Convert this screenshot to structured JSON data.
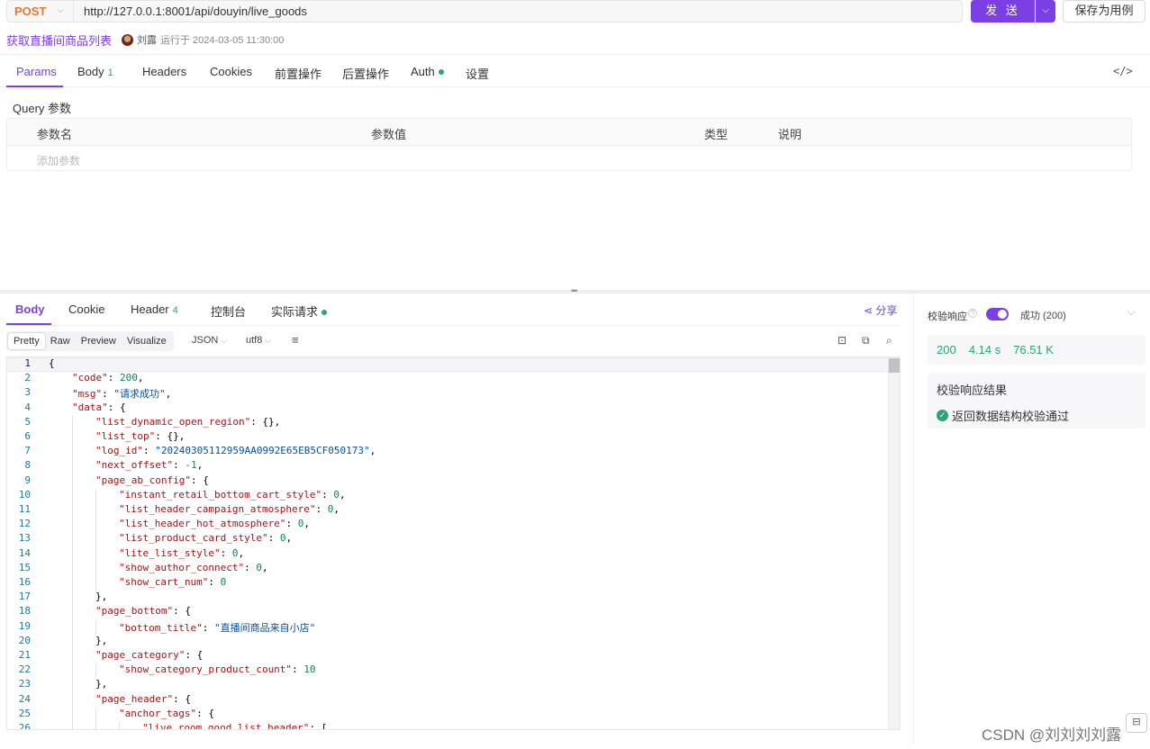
{
  "request": {
    "method": "POST",
    "url": "http://127.0.0.1:8001/api/douyin/live_goods",
    "send_label": "发 送",
    "save_case_label": "保存为用例",
    "case_name": "获取直播间商品列表",
    "runner_name": "刘露",
    "run_info": "运行于 2024-03-05 11:30:00"
  },
  "request_tabs": {
    "params": "Params",
    "body": "Body",
    "body_count": "1",
    "headers": "Headers",
    "cookies": "Cookies",
    "pre": "前置操作",
    "post": "后置操作",
    "auth": "Auth",
    "settings": "设置",
    "code_icon": "</>"
  },
  "query": {
    "title": "Query 参数",
    "columns": [
      "参数名",
      "参数值",
      "类型",
      "说明"
    ],
    "add_placeholder": "添加参数"
  },
  "response_tabs": {
    "body": "Body",
    "cookie": "Cookie",
    "header": "Header",
    "header_count": "4",
    "console": "控制台",
    "actual_request": "实际请求",
    "share": "分享"
  },
  "toolbar": {
    "views": [
      "Pretty",
      "Raw",
      "Preview",
      "Visualize"
    ],
    "format": "JSON",
    "encoding": "utf8"
  },
  "code_lines": [
    {
      "n": "1",
      "i": 0,
      "t": [
        [
          "p",
          "{"
        ]
      ]
    },
    {
      "n": "2",
      "i": 1,
      "t": [
        [
          "k",
          "\"code\""
        ],
        [
          "p",
          ": "
        ],
        [
          "n",
          "200"
        ],
        [
          "p",
          ","
        ]
      ]
    },
    {
      "n": "3",
      "i": 1,
      "t": [
        [
          "k",
          "\"msg\""
        ],
        [
          "p",
          ": "
        ],
        [
          "s",
          "\"请求成功\""
        ],
        [
          "p",
          ","
        ]
      ]
    },
    {
      "n": "4",
      "i": 1,
      "t": [
        [
          "k",
          "\"data\""
        ],
        [
          "p",
          ": {"
        ]
      ]
    },
    {
      "n": "5",
      "i": 2,
      "t": [
        [
          "k",
          "\"list_dynamic_open_region\""
        ],
        [
          "p",
          ": {},"
        ]
      ]
    },
    {
      "n": "6",
      "i": 2,
      "t": [
        [
          "k",
          "\"list_top\""
        ],
        [
          "p",
          ": {},"
        ]
      ]
    },
    {
      "n": "7",
      "i": 2,
      "t": [
        [
          "k",
          "\"log_id\""
        ],
        [
          "p",
          ": "
        ],
        [
          "s",
          "\"20240305112959AA0992E65EB5CF050173\""
        ],
        [
          "p",
          ","
        ]
      ]
    },
    {
      "n": "8",
      "i": 2,
      "t": [
        [
          "k",
          "\"next_offset\""
        ],
        [
          "p",
          ": "
        ],
        [
          "n",
          "-1"
        ],
        [
          "p",
          ","
        ]
      ]
    },
    {
      "n": "9",
      "i": 2,
      "t": [
        [
          "k",
          "\"page_ab_config\""
        ],
        [
          "p",
          ": {"
        ]
      ]
    },
    {
      "n": "10",
      "i": 3,
      "t": [
        [
          "k",
          "\"instant_retail_bottom_cart_style\""
        ],
        [
          "p",
          ": "
        ],
        [
          "n",
          "0"
        ],
        [
          "p",
          ","
        ]
      ]
    },
    {
      "n": "11",
      "i": 3,
      "t": [
        [
          "k",
          "\"list_header_campaign_atmosphere\""
        ],
        [
          "p",
          ": "
        ],
        [
          "n",
          "0"
        ],
        [
          "p",
          ","
        ]
      ]
    },
    {
      "n": "12",
      "i": 3,
      "t": [
        [
          "k",
          "\"list_header_hot_atmosphere\""
        ],
        [
          "p",
          ": "
        ],
        [
          "n",
          "0"
        ],
        [
          "p",
          ","
        ]
      ]
    },
    {
      "n": "13",
      "i": 3,
      "t": [
        [
          "k",
          "\"list_product_card_style\""
        ],
        [
          "p",
          ": "
        ],
        [
          "n",
          "0"
        ],
        [
          "p",
          ","
        ]
      ]
    },
    {
      "n": "14",
      "i": 3,
      "t": [
        [
          "k",
          "\"lite_list_style\""
        ],
        [
          "p",
          ": "
        ],
        [
          "n",
          "0"
        ],
        [
          "p",
          ","
        ]
      ]
    },
    {
      "n": "15",
      "i": 3,
      "t": [
        [
          "k",
          "\"show_author_connect\""
        ],
        [
          "p",
          ": "
        ],
        [
          "n",
          "0"
        ],
        [
          "p",
          ","
        ]
      ]
    },
    {
      "n": "16",
      "i": 3,
      "t": [
        [
          "k",
          "\"show_cart_num\""
        ],
        [
          "p",
          ": "
        ],
        [
          "n",
          "0"
        ]
      ]
    },
    {
      "n": "17",
      "i": 2,
      "t": [
        [
          "p",
          "},"
        ]
      ]
    },
    {
      "n": "18",
      "i": 2,
      "t": [
        [
          "k",
          "\"page_bottom\""
        ],
        [
          "p",
          ": {"
        ]
      ]
    },
    {
      "n": "19",
      "i": 3,
      "t": [
        [
          "k",
          "\"bottom_title\""
        ],
        [
          "p",
          ": "
        ],
        [
          "s",
          "\"直播间商品来自小店\""
        ]
      ]
    },
    {
      "n": "20",
      "i": 2,
      "t": [
        [
          "p",
          "},"
        ]
      ]
    },
    {
      "n": "21",
      "i": 2,
      "t": [
        [
          "k",
          "\"page_category\""
        ],
        [
          "p",
          ": {"
        ]
      ]
    },
    {
      "n": "22",
      "i": 3,
      "t": [
        [
          "k",
          "\"show_category_product_count\""
        ],
        [
          "p",
          ": "
        ],
        [
          "n",
          "10"
        ]
      ]
    },
    {
      "n": "23",
      "i": 2,
      "t": [
        [
          "p",
          "},"
        ]
      ]
    },
    {
      "n": "24",
      "i": 2,
      "t": [
        [
          "k",
          "\"page_header\""
        ],
        [
          "p",
          ": {"
        ]
      ]
    },
    {
      "n": "25",
      "i": 3,
      "t": [
        [
          "k",
          "\"anchor_tags\""
        ],
        [
          "p",
          ": {"
        ]
      ]
    },
    {
      "n": "26",
      "i": 4,
      "t": [
        [
          "k",
          "\"live_room_good_list_header\""
        ],
        [
          "p",
          ": ["
        ]
      ]
    }
  ],
  "validation": {
    "label": "校验响应",
    "help_icon": "?",
    "status_option": "成功 (200)",
    "status_code": "200",
    "time": "4.14 s",
    "size": "76.51 K",
    "result_title": "校验响应结果",
    "result_text": "返回数据结构校验通过"
  },
  "watermark": "CSDN @刘刘刘刘露"
}
